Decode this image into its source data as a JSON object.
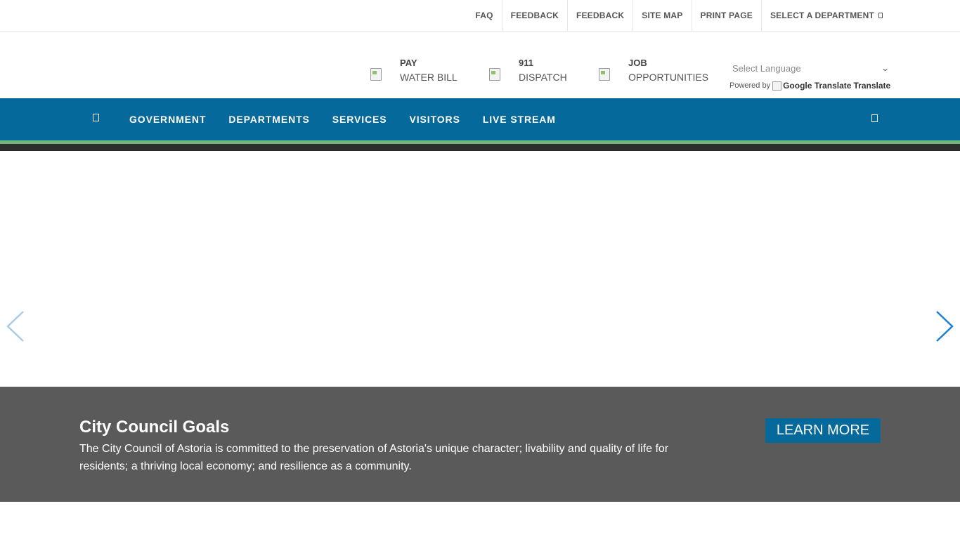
{
  "topbar": {
    "links": [
      "FAQ",
      "FEEDBACK",
      "FEEDBACK",
      "SITE MAP",
      "PRINT PAGE",
      "SELECT A DEPARTMENT"
    ]
  },
  "quicklinks": [
    {
      "top": "PAY",
      "bottom": "WATER BILL",
      "icon": "broken-image-icon"
    },
    {
      "top": "911",
      "bottom": "DISPATCH",
      "icon": "broken-image-icon"
    },
    {
      "top": "JOB",
      "bottom": "OPPORTUNITIES",
      "icon": "broken-image-icon"
    }
  ],
  "translate": {
    "placeholder": "Select Language",
    "powered_by": "Powered by",
    "google_alt": "Google Translate",
    "translate_label": "Translate"
  },
  "nav": {
    "items": [
      "GOVERNMENT",
      "DEPARTMENTS",
      "SERVICES",
      "VISITORS",
      "LIVE STREAM"
    ]
  },
  "caption": {
    "title": "City Council Goals",
    "text": "The City Council of Astoria is committed to the preservation of Astoria's unique character; livability and quality of life for residents; a thriving local economy; and resilience as a community.",
    "button": "LEARN MORE"
  },
  "colors": {
    "nav_bg": "#05699c",
    "accent_green": "#6db87f",
    "caption_bg": "#5a5a5a",
    "arrow_prev": "#a9cbe9",
    "arrow_next": "#1e7fd6"
  }
}
